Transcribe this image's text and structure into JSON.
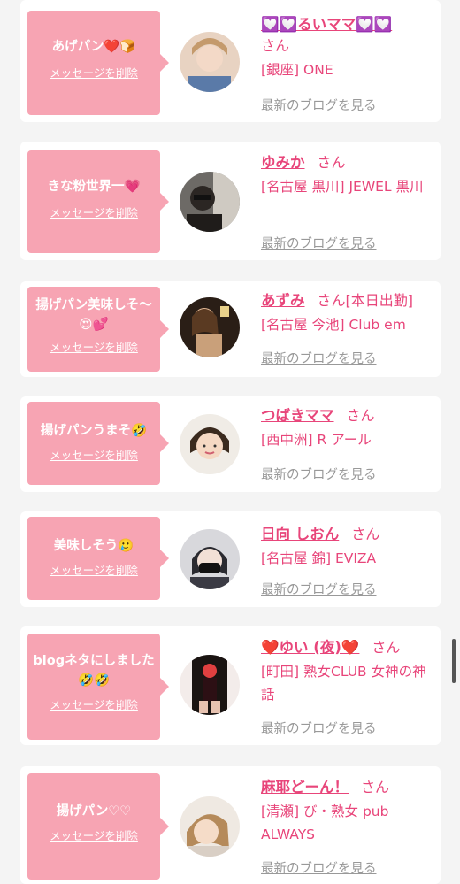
{
  "messages": [
    {
      "message": "あげパン❤️🍞",
      "delete_label": "メッセージを削除",
      "name": "💟💟るいママ💟💟",
      "honorific": "さん",
      "shop": "[銀座] ONE",
      "blog_link": "最新のブログを見る"
    },
    {
      "message": "きな粉世界一💗",
      "delete_label": "メッセージを削除",
      "name": "ゆみか",
      "honorific": "さん",
      "shop": "[名古屋 黒川] JEWEL 黒川",
      "blog_link": "最新のブログを見る"
    },
    {
      "message": "揚げパン美味しそ〜😍💕",
      "delete_label": "メッセージを削除",
      "name": "あずみ",
      "honorific": "さん[本日出勤]",
      "shop": "[名古屋 今池] Club em",
      "blog_link": "最新のブログを見る"
    },
    {
      "message": "揚げパンうまそ🤣",
      "delete_label": "メッセージを削除",
      "name": "つばきママ",
      "honorific": "さん",
      "shop": "[西中洲] R アール",
      "blog_link": "最新のブログを見る"
    },
    {
      "message": "美味しそう🥲",
      "delete_label": "メッセージを削除",
      "name": "日向 しおん",
      "honorific": "さん",
      "shop": "[名古屋 錦] EVIZA",
      "blog_link": "最新のブログを見る"
    },
    {
      "message": "blogネタにしました🤣🤣",
      "delete_label": "メッセージを削除",
      "name": "❤️ゆい (夜)❤️",
      "honorific": "さん",
      "shop": "[町田] 熟女CLUB 女神の神話",
      "blog_link": "最新のブログを見る"
    },
    {
      "message": "揚げパン♡♡",
      "delete_label": "メッセージを削除",
      "name": "麻耶どーん！",
      "honorific": "さん",
      "shop": "[清瀬] び・熟女 pub ALWAYS",
      "blog_link": "最新のブログを見る"
    }
  ],
  "colors": {
    "accent": "#e8457a",
    "bubble": "#f7a4b3",
    "muted": "#999999",
    "background": "#f4f4f4"
  }
}
